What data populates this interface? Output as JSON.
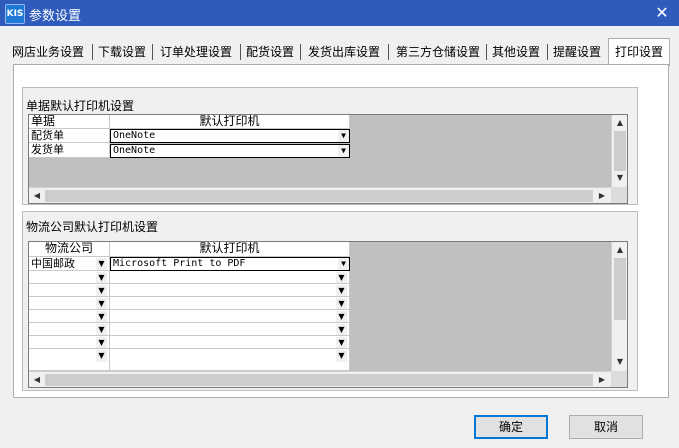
{
  "window": {
    "title": "参数设置",
    "app_icon_text": "KIS",
    "close_glyph": "✕"
  },
  "tabs": [
    {
      "label": "网店业务设置"
    },
    {
      "label": "下载设置"
    },
    {
      "label": "订单处理设置"
    },
    {
      "label": "配货设置"
    },
    {
      "label": "发货出库设置"
    },
    {
      "label": "第三方仓储设置"
    },
    {
      "label": "其他设置"
    },
    {
      "label": "提醒设置"
    },
    {
      "label": "打印设置",
      "active": true
    }
  ],
  "doc_printer_group": {
    "label": "单据默认打印机设置",
    "headers": {
      "doc": "单据",
      "printer": "默认打印机"
    },
    "rows": [
      {
        "doc": "配货单",
        "printer": "OneNote"
      },
      {
        "doc": "发货单",
        "printer": "OneNote"
      }
    ]
  },
  "logistics_printer_group": {
    "label": "物流公司默认打印机设置",
    "headers": {
      "company": "物流公司",
      "printer": "默认打印机"
    },
    "rows": [
      {
        "company": "中国邮政",
        "printer": "Microsoft Print to PDF"
      },
      {
        "company": "",
        "printer": ""
      },
      {
        "company": "",
        "printer": ""
      },
      {
        "company": "",
        "printer": ""
      },
      {
        "company": "",
        "printer": ""
      },
      {
        "company": "",
        "printer": ""
      },
      {
        "company": "",
        "printer": ""
      },
      {
        "company": "",
        "printer": ""
      }
    ]
  },
  "buttons": {
    "ok": "确定",
    "cancel": "取消"
  },
  "glyphs": {
    "dropdown": "▼",
    "up": "▲",
    "down": "▼",
    "left": "◀",
    "right": "▶"
  }
}
